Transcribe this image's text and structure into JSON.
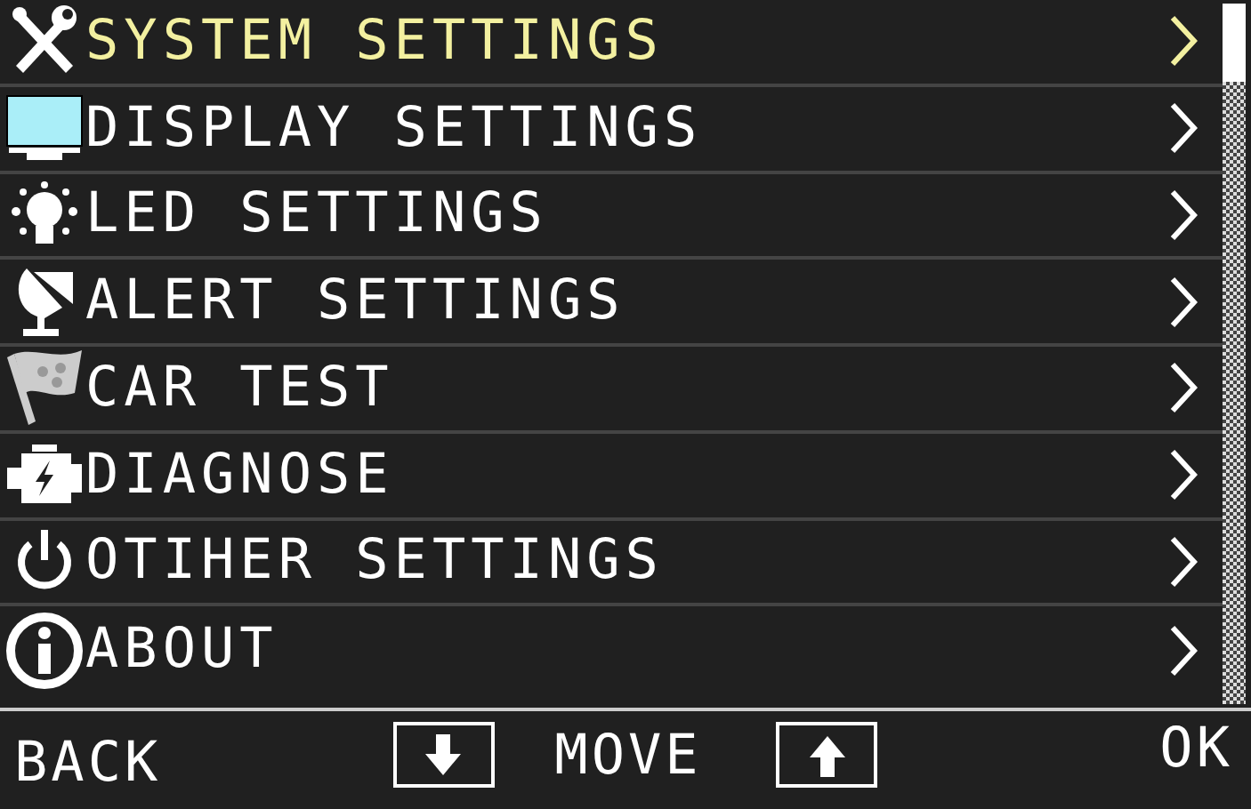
{
  "menu": [
    {
      "label": "SYSTEM SETTINGS",
      "selected": true
    },
    {
      "label": "DISPLAY SETTINGS",
      "selected": false
    },
    {
      "label": "LED SETTINGS",
      "selected": false
    },
    {
      "label": "ALERT SETTINGS",
      "selected": false
    },
    {
      "label": "CAR TEST",
      "selected": false
    },
    {
      "label": "DIAGNOSE",
      "selected": false
    },
    {
      "label": "OTIHER SETTINGS",
      "selected": false
    },
    {
      "label": "ABOUT",
      "selected": false
    }
  ],
  "footer": {
    "back": "BACK",
    "move": "MOVE",
    "ok": "OK"
  }
}
